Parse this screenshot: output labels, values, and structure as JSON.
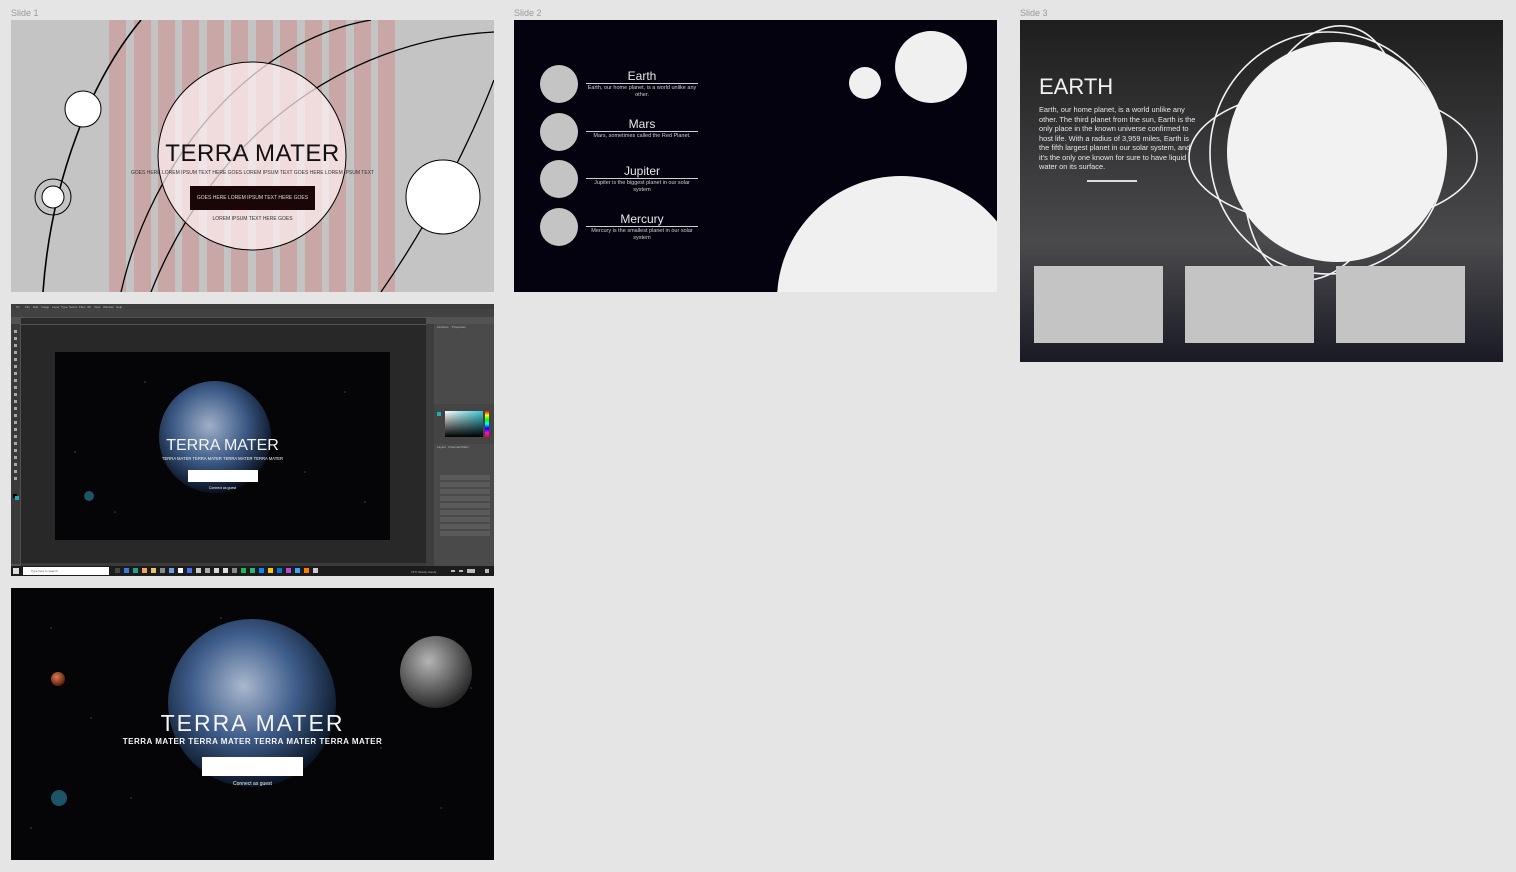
{
  "frames": {
    "slide1": "Slide 1",
    "slide2": "Slide 2",
    "slide3": "Slide 3"
  },
  "slide1": {
    "title": "TERRA MATER",
    "subtitle": "GOES HERE LOREM IPSUM TEXT HERE GOES LOREM IPSUM TEXT GOES HERE LOREM IPSUM TEXT",
    "button_label": "GOES HERE LOREM IPSUM TEXT HERE GOES",
    "footer": "LOREM IPSUM TEXT HERE GOES"
  },
  "slide2": {
    "planets": [
      {
        "name": "Earth",
        "desc": "Earth, our home planet, is a world unlike any other."
      },
      {
        "name": "Mars",
        "desc": "Mars, sometimes called the Red Planet."
      },
      {
        "name": "Jupiter",
        "desc": "Jupiter is the biggest planet in our solar system"
      },
      {
        "name": "Mercury",
        "desc": "Mercury is the smallest planet in our solar system"
      }
    ]
  },
  "slide3": {
    "heading": "EARTH",
    "body": "Earth, our home planet, is a world unlike any other. The third planet from the sun, Earth is the only place in the known universe confirmed to host life. With a radius of 3,959 miles, Earth is the fifth largest planet in our solar system, and it's the only one known for sure to have liquid water on its surface."
  },
  "photoshop": {
    "menu": [
      "File",
      "Edit",
      "Image",
      "Layer",
      "Type",
      "Select",
      "Filter",
      "3D",
      "View",
      "Window",
      "Help"
    ],
    "canvas_title": "TERRA MATER",
    "canvas_subtitle": "TERRA MATER TERRA MATER TERRA MATER TERRA MATER",
    "canvas_link": "Connect as guest",
    "panel_tabs": [
      "Libraries",
      "Properties"
    ],
    "layers_tabs": [
      "Layers",
      "Channels",
      "Paths"
    ],
    "taskbar_search": "Type here to search",
    "weather": "74°F  Mostly cloudy"
  },
  "slide4": {
    "title": "TERRA  MATER",
    "subtitle": "TERRA MATER TERRA MATER TERRA MATER TERRA MATER",
    "link": "Connect as guest"
  },
  "colors": {
    "canvas_bg": "#e5e5e5",
    "slide1_bg": "#c4c4c4",
    "stripe": "#c9a7a7",
    "slide2_bg": "#03020e",
    "placeholder": "#c4c4c4"
  }
}
